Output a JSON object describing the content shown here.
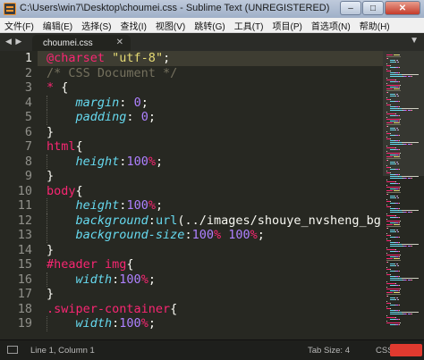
{
  "window": {
    "title": "C:\\Users\\win7\\Desktop\\choumei.css - Sublime Text (UNREGISTERED)",
    "minimize": "–",
    "maximize": "□",
    "close": "✕"
  },
  "menu": [
    "文件(F)",
    "编辑(E)",
    "选择(S)",
    "查找(I)",
    "视图(V)",
    "跳转(G)",
    "工具(T)",
    "项目(P)",
    "首选项(N)",
    "帮助(H)"
  ],
  "tabbar": {
    "nav": "◀ ▶",
    "tab_label": "choumei.css",
    "tab_close": "✕",
    "dropdown": "▼"
  },
  "editor": {
    "line_numbers": [
      "1",
      "2",
      "3",
      "4",
      "5",
      "6",
      "7",
      "8",
      "9",
      "10",
      "11",
      "12",
      "13",
      "14",
      "15",
      "16",
      "17",
      "18",
      "19"
    ],
    "current_line": 1,
    "lines": [
      [
        {
          "t": "@charset",
          "c": "at"
        },
        {
          "t": " ",
          "c": "punc"
        },
        {
          "t": "\"utf-8\"",
          "c": "str"
        },
        {
          "t": ";",
          "c": "punc"
        }
      ],
      [
        {
          "t": "/* CSS Document */",
          "c": "cmt"
        }
      ],
      [
        {
          "t": "*",
          "c": "sel"
        },
        {
          "t": " {",
          "c": "punc"
        }
      ],
      [
        {
          "t": "    ",
          "c": "punc"
        },
        {
          "t": "margin",
          "c": "prop"
        },
        {
          "t": ": ",
          "c": "punc"
        },
        {
          "t": "0",
          "c": "num"
        },
        {
          "t": ";",
          "c": "punc"
        }
      ],
      [
        {
          "t": "    ",
          "c": "punc"
        },
        {
          "t": "padding",
          "c": "prop"
        },
        {
          "t": ": ",
          "c": "punc"
        },
        {
          "t": "0",
          "c": "num"
        },
        {
          "t": ";",
          "c": "punc"
        }
      ],
      [
        {
          "t": "}",
          "c": "punc"
        }
      ],
      [
        {
          "t": "html",
          "c": "sel"
        },
        {
          "t": "{",
          "c": "punc"
        }
      ],
      [
        {
          "t": "    ",
          "c": "punc"
        },
        {
          "t": "height",
          "c": "prop"
        },
        {
          "t": ":",
          "c": "punc"
        },
        {
          "t": "100",
          "c": "num"
        },
        {
          "t": "%",
          "c": "unit"
        },
        {
          "t": ";",
          "c": "punc"
        }
      ],
      [
        {
          "t": "}",
          "c": "punc"
        }
      ],
      [
        {
          "t": "body",
          "c": "sel"
        },
        {
          "t": "{",
          "c": "punc"
        }
      ],
      [
        {
          "t": "    ",
          "c": "punc"
        },
        {
          "t": "height",
          "c": "prop"
        },
        {
          "t": ":",
          "c": "punc"
        },
        {
          "t": "100",
          "c": "num"
        },
        {
          "t": "%",
          "c": "unit"
        },
        {
          "t": ";",
          "c": "punc"
        }
      ],
      [
        {
          "t": "    ",
          "c": "punc"
        },
        {
          "t": "background",
          "c": "prop"
        },
        {
          "t": ":",
          "c": "punc"
        },
        {
          "t": "url",
          "c": "fn"
        },
        {
          "t": "(../images/shouye_nvsheng_bg.png",
          "c": "punc"
        }
      ],
      [
        {
          "t": "    ",
          "c": "punc"
        },
        {
          "t": "background-size",
          "c": "prop"
        },
        {
          "t": ":",
          "c": "punc"
        },
        {
          "t": "100",
          "c": "num"
        },
        {
          "t": "%",
          "c": "unit"
        },
        {
          "t": " ",
          "c": "punc"
        },
        {
          "t": "100",
          "c": "num"
        },
        {
          "t": "%",
          "c": "unit"
        },
        {
          "t": ";",
          "c": "punc"
        }
      ],
      [
        {
          "t": "}",
          "c": "punc"
        }
      ],
      [
        {
          "t": "#header img",
          "c": "sel"
        },
        {
          "t": "{",
          "c": "punc"
        }
      ],
      [
        {
          "t": "    ",
          "c": "punc"
        },
        {
          "t": "width",
          "c": "prop"
        },
        {
          "t": ":",
          "c": "punc"
        },
        {
          "t": "100",
          "c": "num"
        },
        {
          "t": "%",
          "c": "unit"
        },
        {
          "t": ";",
          "c": "punc"
        }
      ],
      [
        {
          "t": "}",
          "c": "punc"
        }
      ],
      [
        {
          "t": ".swiper-container",
          "c": "sel"
        },
        {
          "t": "{",
          "c": "punc"
        }
      ],
      [
        {
          "t": "    ",
          "c": "punc"
        },
        {
          "t": "width",
          "c": "prop"
        },
        {
          "t": ":",
          "c": "punc"
        },
        {
          "t": "100",
          "c": "num"
        },
        {
          "t": "%",
          "c": "unit"
        },
        {
          "t": ";",
          "c": "punc"
        }
      ]
    ]
  },
  "status": {
    "position": "Line 1, Column 1",
    "tab_size": "Tab Size: 4",
    "syntax": "CSS"
  },
  "colors": {
    "background": "#272822",
    "keyword": "#f92672",
    "string": "#e6db74",
    "comment": "#75715e",
    "property": "#66d9ef",
    "number": "#ae81ff"
  }
}
